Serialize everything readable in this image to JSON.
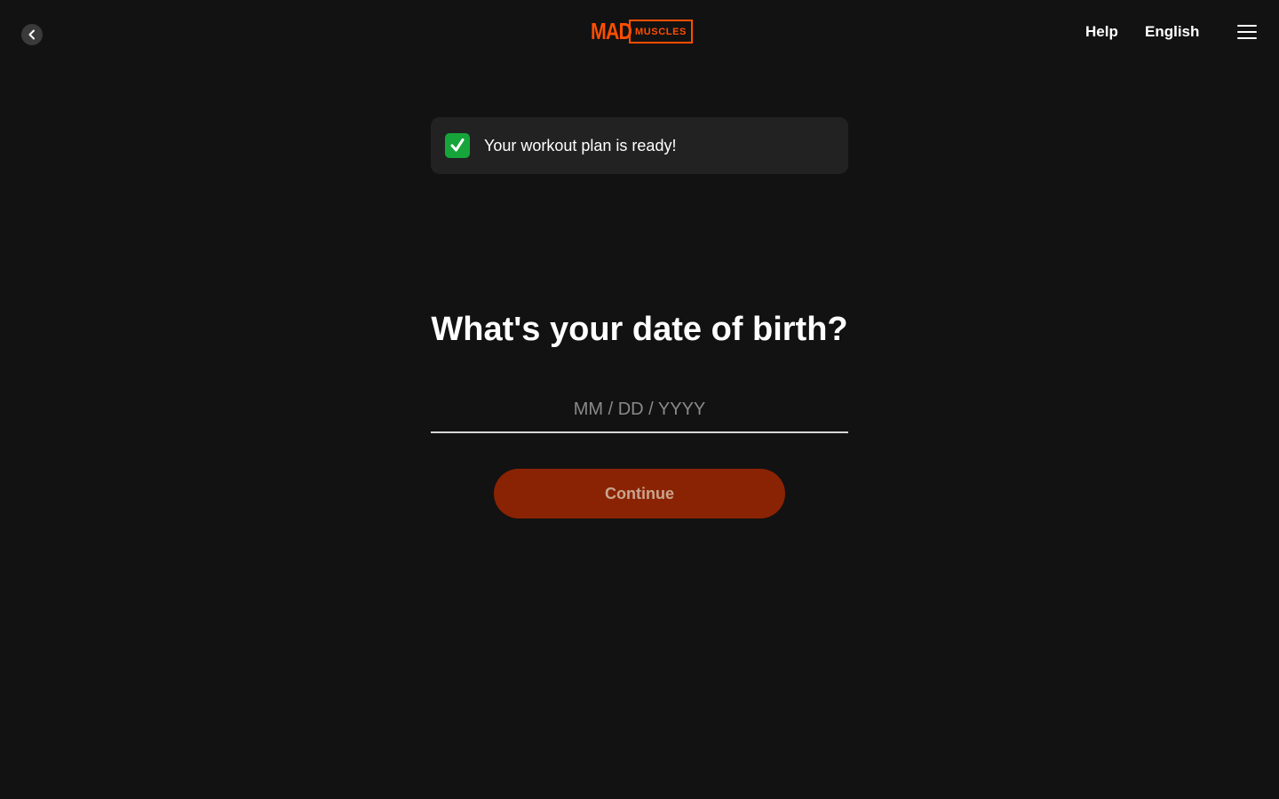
{
  "header": {
    "logo": {
      "primary": "MAD",
      "secondary": "MUSCLES"
    },
    "help_label": "Help",
    "language_label": "English"
  },
  "notice": {
    "text": "Your workout plan is ready!"
  },
  "main": {
    "title": "What's your date of birth?",
    "dob_placeholder": "MM / DD / YYYY",
    "dob_value": "",
    "continue_label": "Continue"
  },
  "colors": {
    "background": "#121212",
    "brand_orange": "#ff4e00",
    "button_disabled": "#8a2303",
    "check_green": "#16a53a",
    "notice_bg": "#222222"
  },
  "icons": {
    "back": "chevron-left-icon",
    "menu": "hamburger-menu-icon",
    "notice": "check-mark-icon"
  }
}
